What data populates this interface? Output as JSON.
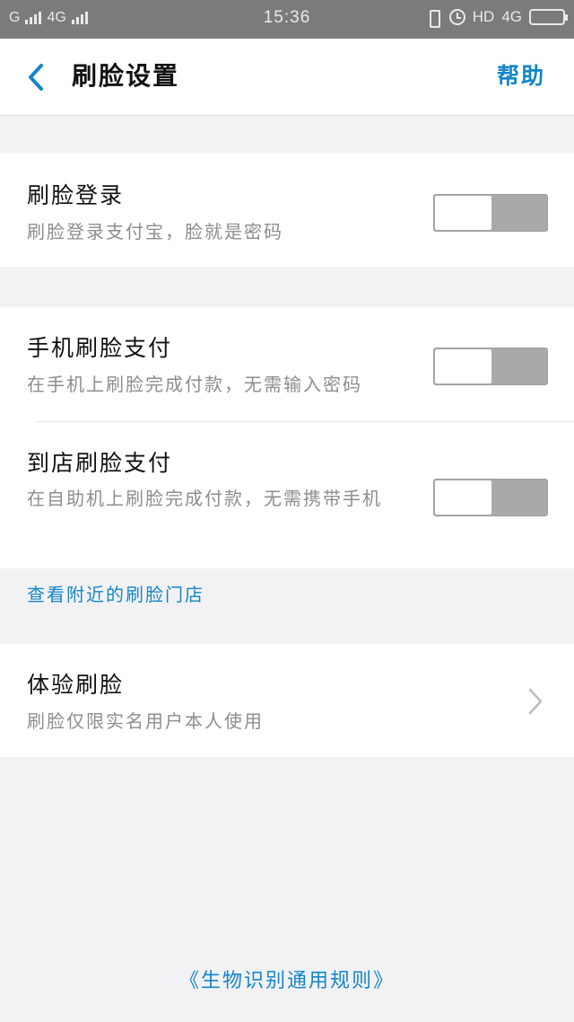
{
  "status_bar": {
    "signal_left": "G",
    "network": "4G",
    "time": "15:36",
    "hd": "HD",
    "network_right": "4G"
  },
  "nav": {
    "title": "刷脸设置",
    "help": "帮助",
    "back_icon": "chevron-left-icon"
  },
  "sections": {
    "face_login": {
      "title": "刷脸登录",
      "subtitle": "刷脸登录支付宝，脸就是密码",
      "enabled": false
    },
    "phone_pay": {
      "title": "手机刷脸支付",
      "subtitle": "在手机上刷脸完成付款，无需输入密码",
      "enabled": false
    },
    "store_pay": {
      "title": "到店刷脸支付",
      "subtitle": "在自助机上刷脸完成付款，无需携带手机",
      "enabled": false
    },
    "nearby_link": "查看附近的刷脸门店",
    "try_face": {
      "title": "体验刷脸",
      "subtitle": "刷脸仅限实名用户本人使用"
    }
  },
  "footer": {
    "rules_link": "《生物识别通用规则》"
  },
  "colors": {
    "accent": "#1486c9",
    "toggle_off": "#a9a9a9",
    "background": "#f2f2f4"
  }
}
